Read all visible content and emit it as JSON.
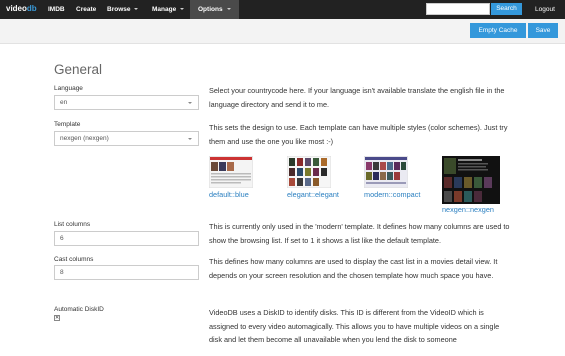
{
  "navbar": {
    "brand_prefix": "video",
    "brand_suffix": "db",
    "items": [
      {
        "label": "IMDB"
      },
      {
        "label": "Create"
      },
      {
        "label": "Browse"
      },
      {
        "label": "Manage"
      },
      {
        "label": "Options"
      }
    ],
    "search_label": "Search",
    "logout_label": "Logout"
  },
  "toolbar": {
    "empty_cache_label": "Empty Cache",
    "save_label": "Save"
  },
  "page": {
    "title": "General"
  },
  "fields": {
    "language": {
      "label": "Language",
      "value": "en",
      "help": "Select your countrycode here. If your language isn't available translate the english file in the language directory and send it to me."
    },
    "template": {
      "label": "Template",
      "value": "nexgen (nexgen)",
      "help": "This sets the design to use. Each template can have multiple styles (color schemes). Just try them and use the one you like most :-)",
      "thumbnails": [
        {
          "label": "default::blue"
        },
        {
          "label": "elegant::elegant"
        },
        {
          "label": "modern::compact"
        },
        {
          "label": "nexgen::nexgen"
        }
      ]
    },
    "list_columns": {
      "label": "List columns",
      "value": "6",
      "help": "This is currently only used in the 'modern' template. It defines how many columns are used to show the browsing list. If set to 1 it shows a list like the default template."
    },
    "cast_columns": {
      "label": "Cast columns",
      "value": "8",
      "help": "This defines how many columns are used to display the cast list in a movies detail view. It depends on your screen resolution and the chosen template how much space you have."
    },
    "automatic_diskid": {
      "label": "Automatic DiskID",
      "checked": true,
      "help": "VideoDB uses a DiskID to identify disks. This ID is different from the VideoID which is assigned to every video automagically. This allows you to have multiple videos on a single disk and let them become all unavailable when you lend the disk to someone"
    }
  },
  "colors": {
    "navbar_bg": "#222222",
    "accent": "#3498db",
    "link": "#2a7fc0",
    "toolbar_bg": "#f3f3f3"
  }
}
